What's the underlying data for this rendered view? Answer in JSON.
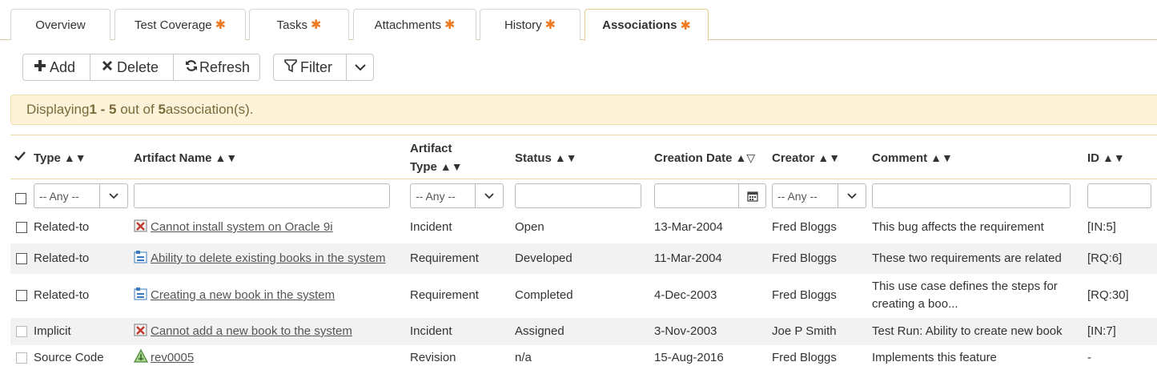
{
  "tabs": [
    {
      "label": "Overview",
      "star": ""
    },
    {
      "label": "Test Coverage",
      "star": "✱"
    },
    {
      "label": "Tasks",
      "star": "✱"
    },
    {
      "label": "Attachments",
      "star": "✱"
    },
    {
      "label": "History",
      "star": "✱"
    },
    {
      "label": "Associations",
      "star": "✱"
    }
  ],
  "toolbar": {
    "add": "Add",
    "delete": "Delete",
    "refresh": "Refresh",
    "filter": "Filter"
  },
  "banner": {
    "prefix": "Displaying ",
    "range": "1 - 5",
    "middle": " out of ",
    "total": "5",
    "suffix": " association(s)."
  },
  "columns": {
    "type": "Type",
    "artifact_name": "Artifact Name",
    "artifact_type": "Artifact Type",
    "status": "Status",
    "creation_date": "Creation Date",
    "creator": "Creator",
    "comment": "Comment",
    "id": "ID"
  },
  "sort_arrows": "▲▼",
  "sort_arrows_date": "▲▽",
  "filters": {
    "type_any": "-- Any --",
    "artifact_type_any": "-- Any --",
    "creator_any": "-- Any --"
  },
  "rows": [
    {
      "type": "Related-to",
      "name": "Cannot install system on Oracle 9i",
      "icon": "incident-icon",
      "artifact_type": "Incident",
      "status": "Open",
      "date": "13-Mar-2004",
      "creator": "Fred Bloggs",
      "comment": "This bug affects the requirement",
      "id": "[IN:5]"
    },
    {
      "type": "Related-to",
      "name": "Ability to delete existing books in the system",
      "icon": "requirement-icon",
      "artifact_type": "Requirement",
      "status": "Developed",
      "date": "11-Mar-2004",
      "creator": "Fred Bloggs",
      "comment": "These two requirements are related",
      "id": "[RQ:6]"
    },
    {
      "type": "Related-to",
      "name": "Creating a new book in the system",
      "icon": "requirement-icon",
      "artifact_type": "Requirement",
      "status": "Completed",
      "date": "4-Dec-2003",
      "creator": "Fred Bloggs",
      "comment": "This use case defines the steps for creating a boo...",
      "id": "[RQ:30]"
    },
    {
      "type": "Implicit",
      "name": "Cannot add a new book to the system",
      "icon": "incident-icon",
      "artifact_type": "Incident",
      "status": "Assigned",
      "date": "3-Nov-2003",
      "creator": "Joe P Smith",
      "comment": "Test Run: Ability to create new book",
      "id": "[IN:7]"
    },
    {
      "type": "Source Code",
      "name": "rev0005",
      "icon": "revision-icon",
      "artifact_type": "Revision",
      "status": "n/a",
      "date": "15-Aug-2016",
      "creator": "Fred Bloggs",
      "comment": "Implements this feature",
      "id": "-"
    }
  ]
}
